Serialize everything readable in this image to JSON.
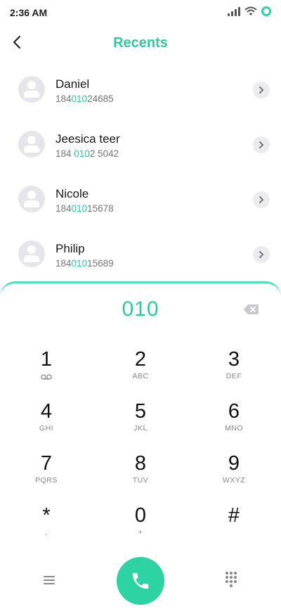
{
  "status_bar": {
    "time": "2:36 AM"
  },
  "header": {
    "title": "Recents"
  },
  "contacts": [
    {
      "name": "Daniel",
      "number_pre": "184",
      "number_match": "010",
      "number_post": "24685"
    },
    {
      "name": "Jeesica teer",
      "number_pre": "184 ",
      "number_match": "010",
      "number_post": "2 5042"
    },
    {
      "name": "Nicole",
      "number_pre": "184",
      "number_match": "010",
      "number_post": "15678"
    },
    {
      "name": "Philip",
      "number_pre": "184",
      "number_match": "010",
      "number_post": "15689"
    }
  ],
  "dialer": {
    "input": "010",
    "keys": [
      {
        "digit": "1",
        "letters": ""
      },
      {
        "digit": "2",
        "letters": "ABC"
      },
      {
        "digit": "3",
        "letters": "DEF"
      },
      {
        "digit": "4",
        "letters": "GHI"
      },
      {
        "digit": "5",
        "letters": "JKL"
      },
      {
        "digit": "6",
        "letters": "MNO"
      },
      {
        "digit": "7",
        "letters": "PQRS"
      },
      {
        "digit": "8",
        "letters": "TUV"
      },
      {
        "digit": "9",
        "letters": "WXYZ"
      },
      {
        "digit": "*",
        "letters": ","
      },
      {
        "digit": "0",
        "letters": "+"
      },
      {
        "digit": "#",
        "letters": ""
      }
    ]
  },
  "icons": {
    "back": "chevron-left-icon",
    "detail": "chevron-right-icon",
    "voicemail": "voicemail-icon",
    "backspace": "backspace-icon",
    "menu": "menu-icon",
    "call": "phone-icon",
    "keypad": "keypad-icon"
  },
  "colors": {
    "accent": "#2ecc9a",
    "call_button": "#2ed3a4",
    "panel_border": "#4ee0b8"
  }
}
